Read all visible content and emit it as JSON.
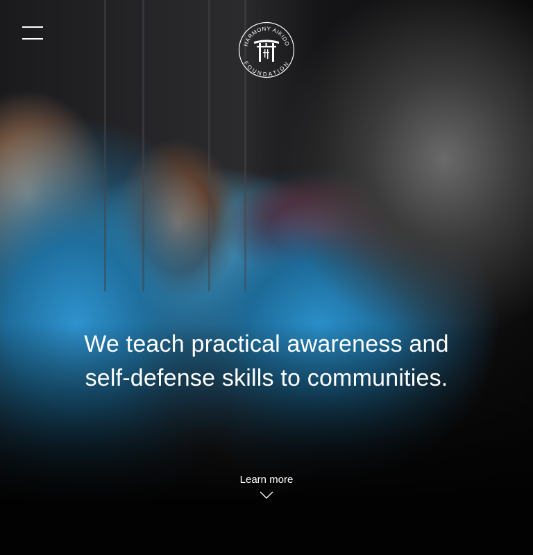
{
  "header": {
    "menu_icon": "hamburger-menu-icon",
    "logo": {
      "arc_top": "HARMONY AIKIDO",
      "arc_bottom": "FOUNDATION",
      "icon": "torii-gate-icon"
    }
  },
  "hero": {
    "headline_line1": "We teach practical awareness and",
    "headline_line2": "self-defense skills to communities.",
    "learn_more_label": "Learn more",
    "learn_more_icon": "chevron-down-icon"
  },
  "colors": {
    "text": "#ffffff",
    "background": "#020202"
  }
}
